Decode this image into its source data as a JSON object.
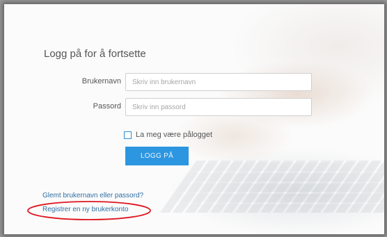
{
  "login": {
    "heading": "Logg på for å fortsette",
    "username": {
      "label": "Brukernavn",
      "placeholder": "Skriv inn brukernavn"
    },
    "password": {
      "label": "Passord",
      "placeholder": "Skriv inn passord"
    },
    "remember_label": "La meg være pålogget",
    "remember_checked": false,
    "submit_label": "LOGG PÅ"
  },
  "links": {
    "forgot": "Glemt brukernavn eller passord?",
    "register": "Registrer en ny brukerkonto"
  },
  "colors": {
    "accent": "#2d96e0",
    "link": "#2e6fa3",
    "annotation": "#e0141e"
  }
}
